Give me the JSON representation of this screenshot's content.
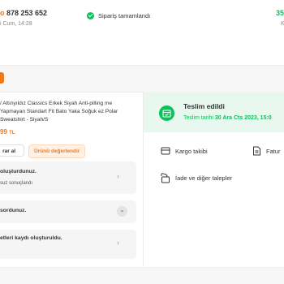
{
  "header": {
    "order_prefix": "o",
    "order_number": "878 253 652",
    "order_date": "i Cum, 14:28",
    "status": "Sipariş tamamlandı",
    "total": "35",
    "total_sub": "K"
  },
  "product": {
    "name": "/ Altınyıldız Classics Erkek Siyah Anti-pilling me Yapmayan Standart Fit Bato Yaka Soğuk ez Polar Sweatshirt - Siyah/S",
    "price": "99",
    "currency": "TL"
  },
  "buttons": {
    "reorder": "rar al",
    "review": "Ürünü değerlendir"
  },
  "status_boxes": [
    {
      "title": "oluşturdunuz.",
      "subtitle": "suz sonuçlandı"
    },
    {
      "title": "sordunuz."
    },
    {
      "title": "etleri kaydı oluşturuldu."
    }
  ],
  "delivery": {
    "title": "Teslim edildi",
    "date_label": "Teslim tarihi",
    "date_value": "30 Ara Cts 2023, 15:0"
  },
  "actions": {
    "tracking": "Kargo takibi",
    "invoice": "Fatur",
    "returns": "İade ve diğer talepler"
  },
  "colors": {
    "brand_orange": "#f27a1a",
    "success_green": "#0bc15c",
    "delivered_bg": "#e8f8ee"
  }
}
